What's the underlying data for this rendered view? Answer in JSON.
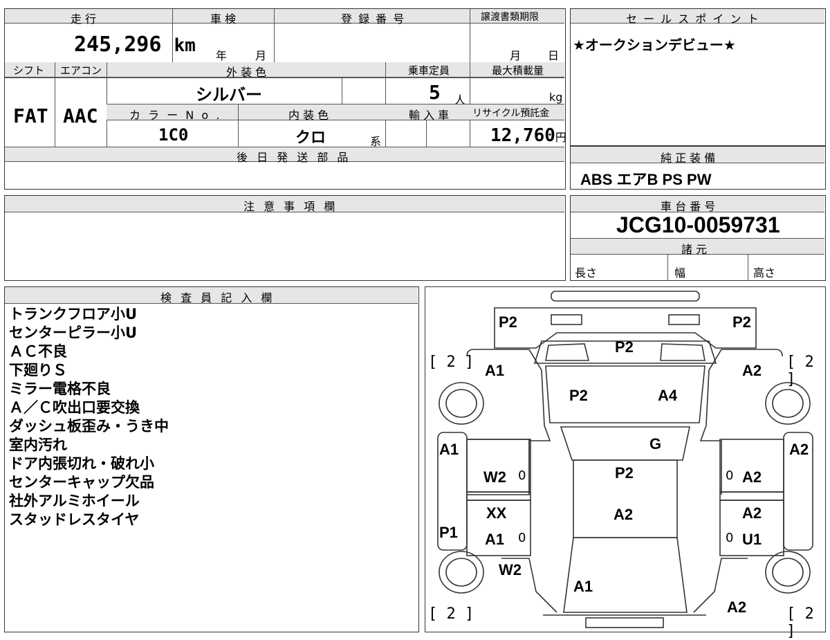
{
  "vehicle": {
    "mileage_label": "走 行",
    "mileage_value": "245,296",
    "mileage_unit": "km",
    "shaken_label": "車 検",
    "shaken_year_unit": "年",
    "shaken_month_unit": "月",
    "reg_label": "登 録 番 号",
    "transfer_label": "譲渡書類期限",
    "transfer_month_unit": "月",
    "transfer_day_unit": "日",
    "shift_label": "シフト",
    "shift_value": "FAT",
    "ac_label": "エアコン",
    "ac_value": "AAC",
    "ext_color_label": "外 装 色",
    "ext_color_value": "シルバー",
    "capacity_label": "乗車定員",
    "capacity_value": "5",
    "capacity_unit": "人",
    "maxload_label": "最大積載量",
    "maxload_unit": "kg",
    "color_no_label": "カ ラ ー N o .",
    "color_no_value": "1C0",
    "int_color_label": "内 装 色",
    "int_color_value": "クロ",
    "int_color_unit": "系",
    "import_label": "輸 入 車",
    "recycle_label": "リサイクル預託金",
    "recycle_value": "12,760",
    "recycle_unit": "円",
    "later_parts_label": "後 日 発 送 部 品"
  },
  "sales_point": {
    "label": "セ ー ル ス ポ イ ン ト",
    "text": "★オークションデビュー★"
  },
  "equipment": {
    "label": "純 正 装 備",
    "text": "ABS エアB PS PW"
  },
  "caution": {
    "label": "注 意 事 項 欄"
  },
  "chassis": {
    "label": "車 台 番 号",
    "value": "JCG10-0059731",
    "spec_label": "諸 元",
    "length_label": "長さ",
    "width_label": "幅",
    "height_label": "高さ"
  },
  "inspector": {
    "label": "検 査 員 記 入 欄",
    "notes": [
      "トランクフロア小U",
      "センターピラー小U",
      "ＡＣ不良",
      "下廻りＳ",
      "ミラー電格不良",
      "Ａ／Ｃ吹出口要交換",
      "ダッシュ板歪み・うき中",
      "室内汚れ",
      "ドア内張切れ・破れ小",
      "センターキャップ欠品",
      "社外アルミホイール",
      "スタッドレスタイヤ"
    ]
  },
  "diagram_marks": {
    "rear_left": "P2",
    "rear_right": "P2",
    "rear_glass": "P2",
    "tire_bracket_tl": "[ 2 ]",
    "tire_bracket_tr": "[ 2 ]",
    "tire_bracket_bl": "[ 2 ]",
    "tire_bracket_br": "[ 2 ]",
    "rear_fender_l": "A1",
    "rear_fender_r": "A2",
    "roof_left": "P2",
    "roof_right": "A4",
    "windshield": "G",
    "side_l_upper": "A1",
    "side_r_upper": "A2",
    "rear_door_l": "W2",
    "rear_door_l_zero": "0",
    "rear_door_r": "A2",
    "rear_door_r_zero": "0",
    "front_door_l_top": "XX",
    "front_door_l": "A1",
    "front_door_l_zero": "0",
    "front_door_r_top": "A2",
    "front_door_r": "U1",
    "front_door_r_zero": "0",
    "center_upper": "P2",
    "center_lower": "A2",
    "side_l_lower": "P1",
    "front_fender_l": "W2",
    "hood": "A1",
    "front_fender_r": "A2"
  }
}
